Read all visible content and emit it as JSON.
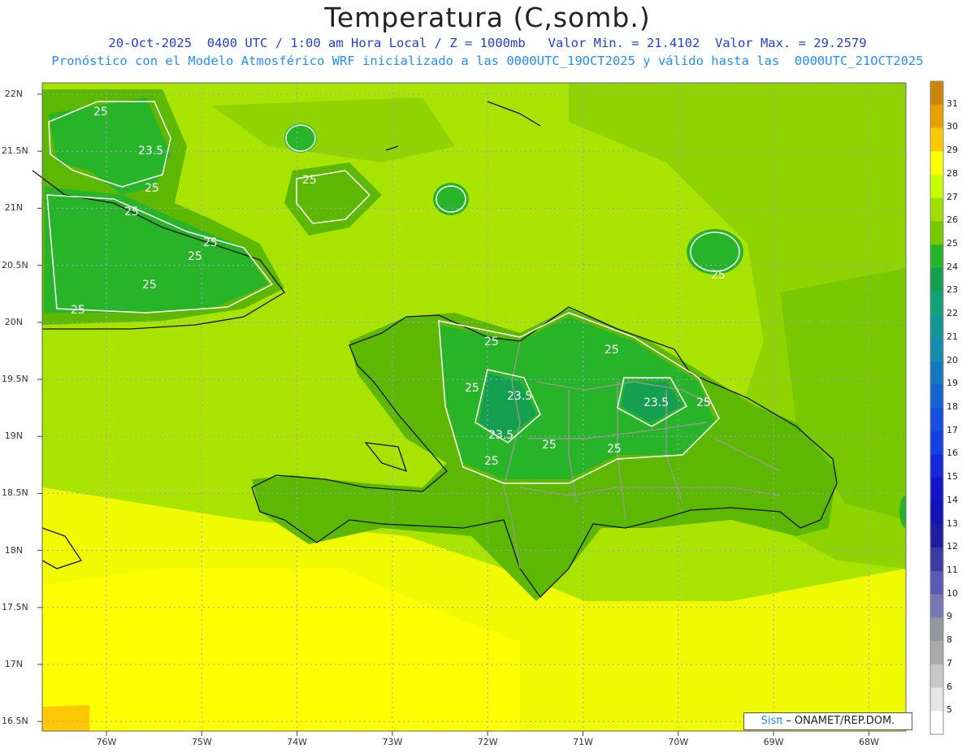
{
  "title": "Temperatura (C,somb.)",
  "subtitle_line1": "20-Oct-2025  0400 UTC / 1:00 am Hora Local / Z = 1000mb   Valor Min. = 21.4102  Valor Max. = 29.2579",
  "subtitle_line2": "Pronóstico con el Modelo Atmosférico WRF inicializado a las 0000UTC_19OCT2025 y válido hasta las  0000UTC_21OCT2025",
  "lat_labels": [
    "22N",
    "21.5N",
    "21N",
    "20.5N",
    "20N",
    "19.5N",
    "19N",
    "18.5N",
    "18N",
    "17.5N",
    "17N",
    "16.5N"
  ],
  "lon_labels": [
    "76W",
    "75W",
    "74W",
    "73W",
    "72W",
    "71W",
    "70W",
    "69W",
    "68W"
  ],
  "colorbar": {
    "labels": [
      "31",
      "30",
      "29",
      "28",
      "27",
      "26",
      "25",
      "24",
      "23",
      "22",
      "21",
      "20",
      "19",
      "18",
      "17",
      "16",
      "15",
      "14",
      "13",
      "12",
      "11",
      "10",
      "9",
      "8",
      "7",
      "6",
      "5"
    ],
    "colors": [
      "#c8860a",
      "#e8a000",
      "#ffc800",
      "#ffff00",
      "#c8ff00",
      "#a0e000",
      "#78c800",
      "#28b428",
      "#14a050",
      "#14a078",
      "#149696",
      "#148caa",
      "#1478be",
      "#1464d2",
      "#1450dc",
      "#1440e6",
      "#1428dc",
      "#1414c8",
      "#1414b4",
      "#1e1ea0",
      "#3c3ca0",
      "#5a5ab4",
      "#7878b4",
      "#9696a0",
      "#aaaaaa",
      "#c8c8c8",
      "#e6e6e6",
      "#ffffff"
    ]
  },
  "contour_labels": [
    "25",
    "23.5",
    "25",
    "25",
    "25",
    "25",
    "25",
    "25",
    "25",
    "25",
    "25",
    "25",
    "25",
    "25",
    "23.5",
    "23.5",
    "25",
    "25",
    "25",
    "23.5",
    "25",
    "25"
  ],
  "credit": {
    "brand": "Sisπ",
    "rest": "– ONAMET/REP.DOM."
  }
}
